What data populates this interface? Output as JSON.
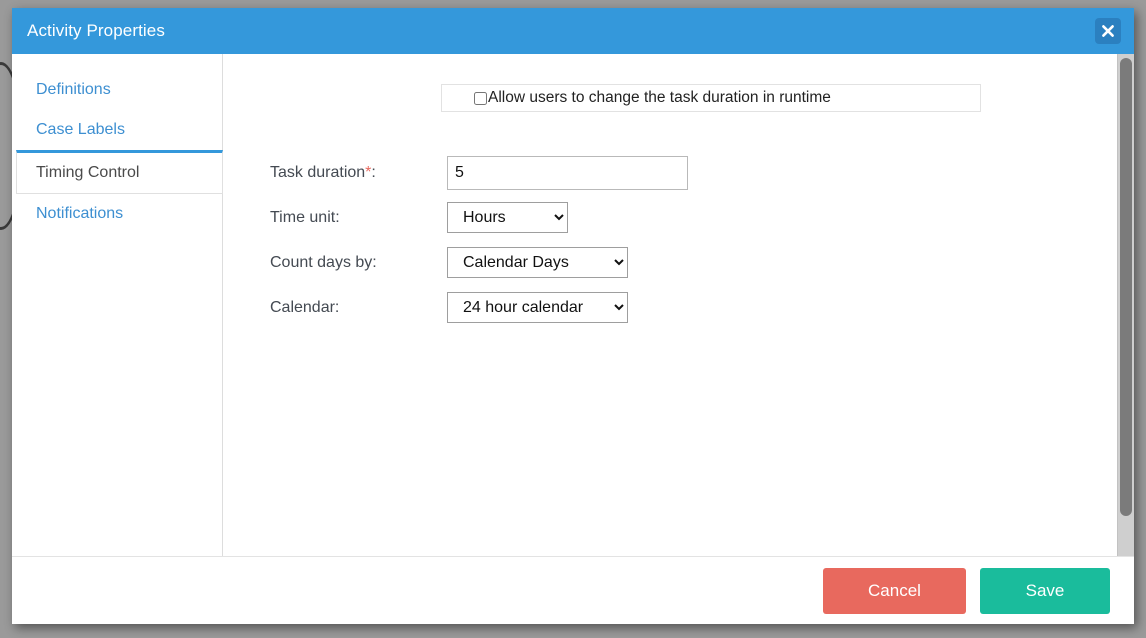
{
  "dialog": {
    "title": "Activity Properties",
    "close_icon": "close-x-icon",
    "accent_color": "#3498db"
  },
  "sidebar": {
    "items": [
      {
        "label": "Definitions",
        "active": false
      },
      {
        "label": "Case Labels",
        "active": false
      },
      {
        "label": "Timing Control",
        "active": true
      },
      {
        "label": "Notifications",
        "active": false
      }
    ]
  },
  "content": {
    "allow_duration": {
      "label": "Allow users to change the task duration in runtime",
      "checked": false
    },
    "fields": {
      "task_duration": {
        "label": "Task duration",
        "required_mark": "*",
        "suffix": ":",
        "value": "5",
        "placeholder": ""
      },
      "time_unit": {
        "label": "Time unit:",
        "selected": "Hours",
        "options": [
          "Hours"
        ]
      },
      "count_days_by": {
        "label": "Count days by:",
        "selected": "Calendar Days",
        "options": [
          "Calendar Days"
        ]
      },
      "calendar": {
        "label": "Calendar:",
        "selected": "24 hour calendar",
        "options": [
          "24 hour calendar"
        ]
      }
    }
  },
  "footer": {
    "cancel_label": "Cancel",
    "save_label": "Save",
    "cancel_color": "#e8695e",
    "save_color": "#1abc9c"
  }
}
